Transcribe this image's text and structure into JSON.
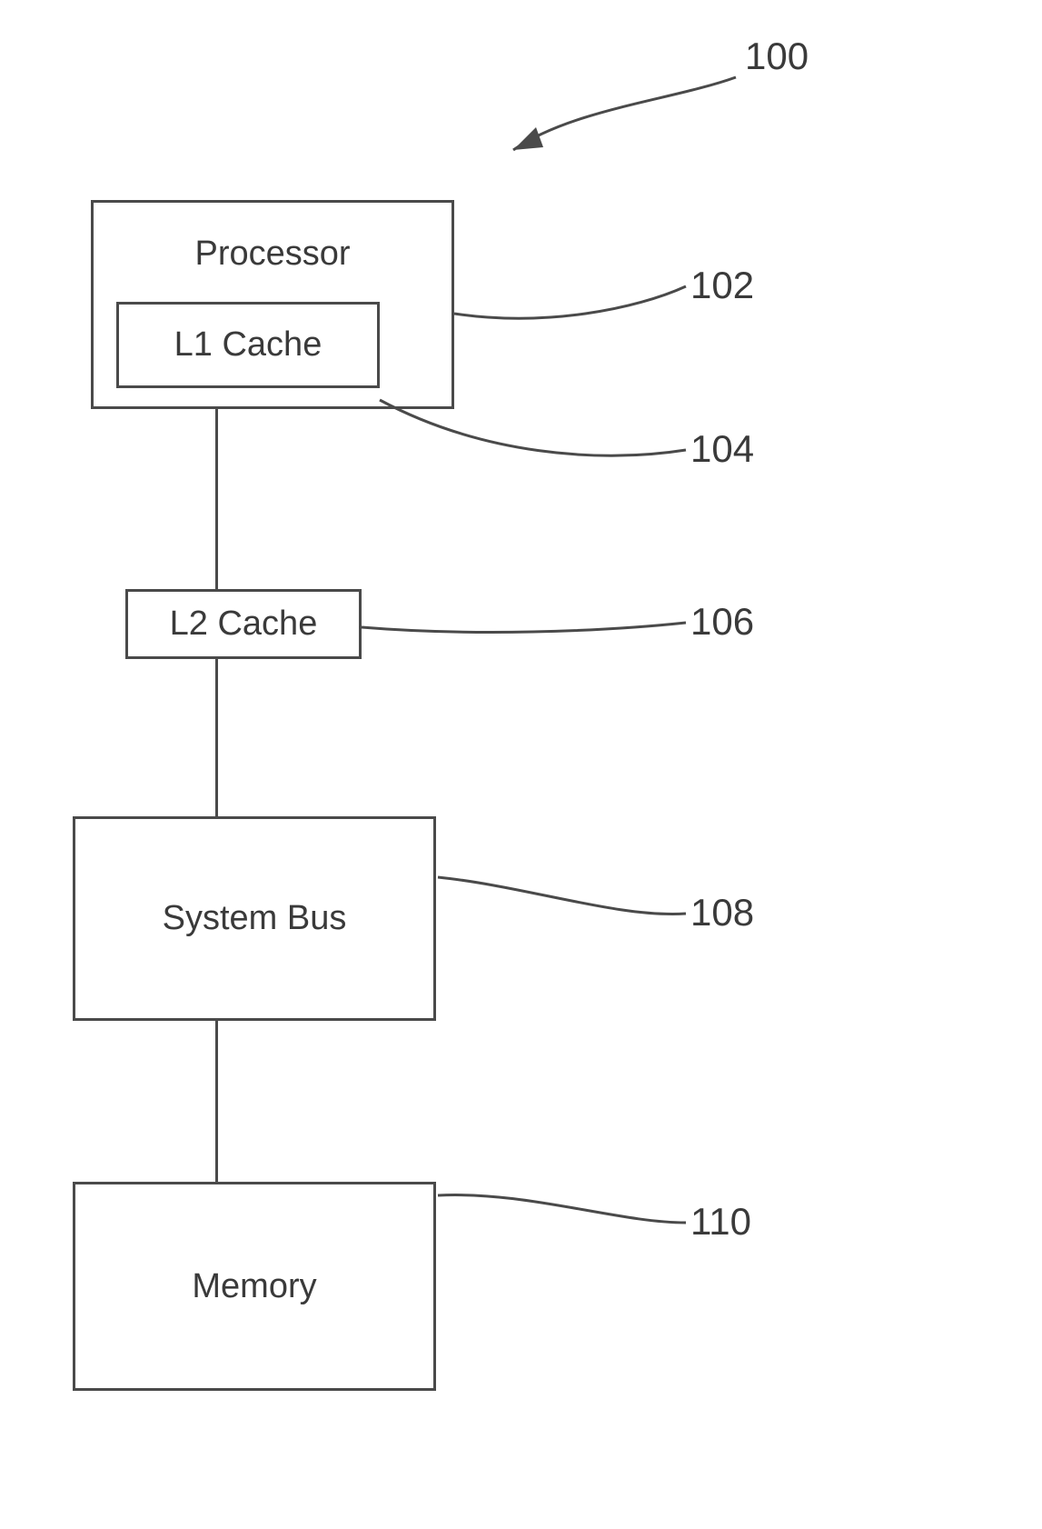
{
  "diagram": {
    "ref_main": "100",
    "processor": {
      "title": "Processor",
      "ref": "102"
    },
    "l1_cache": {
      "title": "L1 Cache",
      "ref": "104"
    },
    "l2_cache": {
      "title": "L2 Cache",
      "ref": "106"
    },
    "system_bus": {
      "title": "System Bus",
      "ref": "108"
    },
    "memory": {
      "title": "Memory",
      "ref": "110"
    }
  }
}
